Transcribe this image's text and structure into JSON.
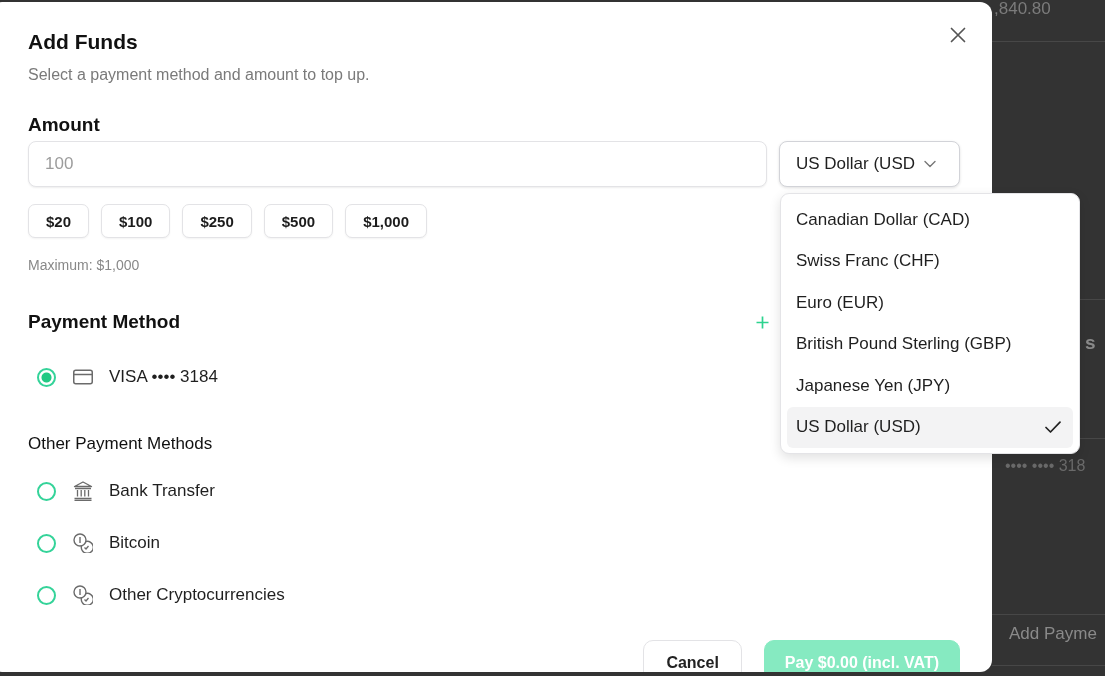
{
  "background_page": {
    "rows": [
      {
        "text": ",840.80",
        "kind": "amount"
      },
      {
        "text": "s",
        "kind": "heading"
      },
      {
        "text": "•••• •••• 318",
        "kind": "card"
      },
      {
        "text": "Add Payme",
        "kind": "action"
      }
    ]
  },
  "dialog": {
    "title": "Add Funds",
    "subtitle": "Select a payment method and amount to top up.",
    "amount": {
      "label": "Amount",
      "placeholder": "100",
      "currency": {
        "value": "US Dollar (USD",
        "expanded": true,
        "options": [
          {
            "label": "Canadian Dollar (CAD)",
            "selected": false
          },
          {
            "label": "Swiss Franc (CHF)",
            "selected": false
          },
          {
            "label": "Euro (EUR)",
            "selected": false
          },
          {
            "label": "British Pound Sterling (GBP)",
            "selected": false
          },
          {
            "label": "Japanese Yen (JPY)",
            "selected": false
          },
          {
            "label": "US Dollar (USD)",
            "selected": true
          }
        ]
      },
      "presets": [
        "$20",
        "$100",
        "$250",
        "$500",
        "$1,000"
      ],
      "hint": "Maximum: $1,000"
    },
    "payment_method": {
      "label": "Payment Method",
      "methods": [
        {
          "label": "VISA •••• 3184",
          "kind": "card",
          "selected": true
        }
      ]
    },
    "other_methods": {
      "label": "Other Payment Methods",
      "methods": [
        {
          "label": "Bank Transfer",
          "kind": "bank",
          "selected": false
        },
        {
          "label": "Bitcoin",
          "kind": "crypto",
          "selected": false
        },
        {
          "label": "Other Cryptocurrencies",
          "kind": "crypto",
          "selected": false
        }
      ]
    },
    "buttons": [
      {
        "label": "Cancel",
        "kind": "secondary",
        "disabled": false
      },
      {
        "label": "Pay $0.00 (incl. VAT)",
        "kind": "primary",
        "disabled": true
      }
    ]
  }
}
